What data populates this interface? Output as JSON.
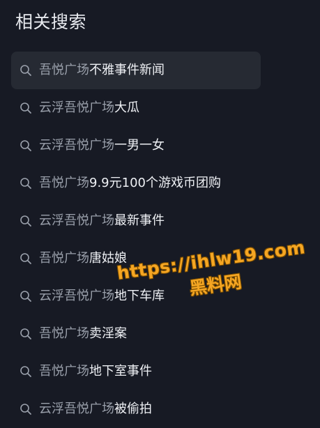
{
  "section": {
    "title": "相关搜索"
  },
  "colors": {
    "background": "#171a24",
    "highlight_row": "#262a33",
    "muted_text": "#9aa0ab",
    "bright_text": "#eef0f4",
    "watermark": "#f5a623"
  },
  "suggestions": [
    {
      "prefix": "吾悦广场",
      "suffix": "不雅事件新闻",
      "icon": "search-icon"
    },
    {
      "prefix": "云浮吾悦广场",
      "suffix": "大瓜",
      "icon": "search-icon"
    },
    {
      "prefix": "云浮吾悦广场",
      "suffix": "一男一女",
      "icon": "search-icon"
    },
    {
      "prefix": "吾悦广场",
      "suffix": "9.9元100个游戏币团购",
      "icon": "search-icon"
    },
    {
      "prefix": "云浮吾悦广场",
      "suffix": "最新事件",
      "icon": "search-icon"
    },
    {
      "prefix": "吾悦广场",
      "suffix": "唐姑娘",
      "icon": "search-icon"
    },
    {
      "prefix": "云浮吾悦广场",
      "suffix": "地下车库",
      "icon": "search-icon"
    },
    {
      "prefix": "吾悦广场",
      "suffix": "卖淫案",
      "icon": "search-icon"
    },
    {
      "prefix": "吾悦广场",
      "suffix": "地下室事件",
      "icon": "search-icon"
    },
    {
      "prefix": "云浮吾悦广场",
      "suffix": "被偷拍",
      "icon": "search-icon"
    }
  ],
  "watermark": {
    "line1": "https://ihlw19.com",
    "line2": "黑料网"
  }
}
